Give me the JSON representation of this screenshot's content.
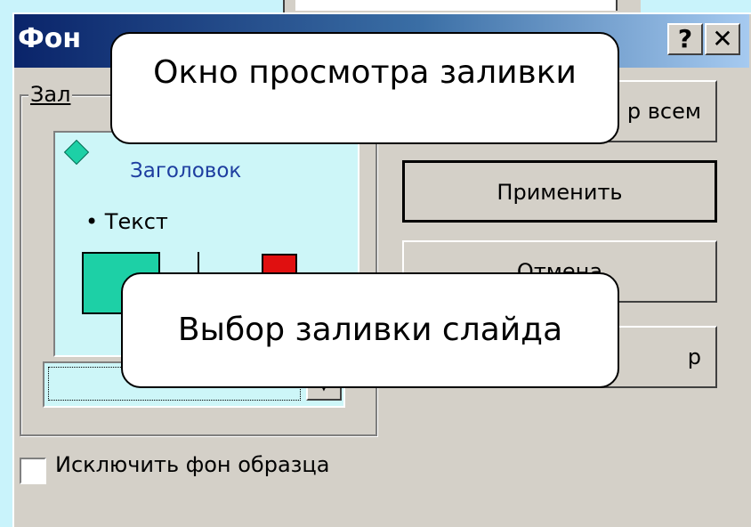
{
  "dialog": {
    "title": "Фон",
    "help_label": "?",
    "close_label": "✕"
  },
  "fill_group": {
    "label": "Зал",
    "preview_heading": "Заголовок",
    "preview_bullet": "• Текст"
  },
  "buttons": {
    "apply_all_partial": "р всем",
    "apply": "Применить",
    "cancel_partial": "Отмена",
    "preview_partial": "р"
  },
  "checkbox": {
    "label": "Исключить фон образца",
    "checked": false
  },
  "callouts": {
    "top": "Окно просмотра заливки",
    "bottom": "Выбор заливки слайда"
  },
  "colors": {
    "background": "#c9f3fb",
    "titlebar_start": "#0a246a",
    "titlebar_end": "#a6caf0",
    "preview_bg": "#cdf6f8",
    "shape_green": "#1dd0a6",
    "shape_red": "#e01010"
  }
}
